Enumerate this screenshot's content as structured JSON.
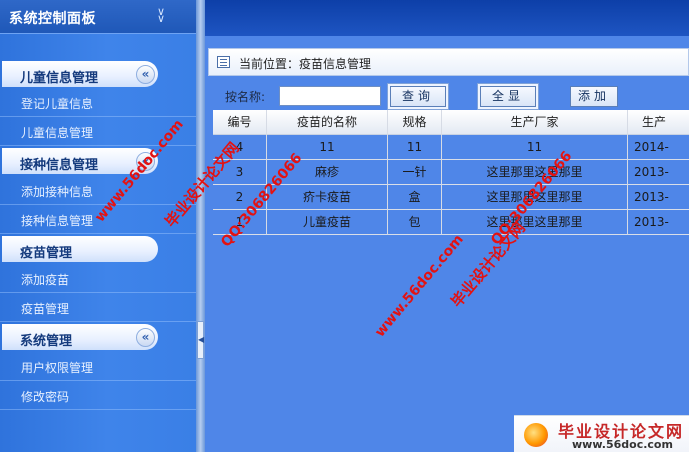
{
  "sidebar": {
    "title": "系统控制面板",
    "collapse_icon": "double-chevron-down-icon",
    "sections": [
      {
        "label": "儿童信息管理",
        "items": [
          "登记儿童信息",
          "儿童信息管理"
        ]
      },
      {
        "label": "接种信息管理",
        "items": [
          "添加接种信息",
          "接种信息管理"
        ]
      },
      {
        "label": "疫苗管理",
        "items": [
          "添加疫苗",
          "疫苗管理"
        ]
      },
      {
        "label": "系统管理",
        "items": [
          "用户权限管理",
          "修改密码"
        ]
      }
    ]
  },
  "main": {
    "breadcrumb": "当前位置：疫苗信息管理",
    "toolbar": {
      "search_label": "按名称:",
      "search_value": "",
      "query_button": "查询",
      "show_all_button": "全显",
      "add_button": "添加"
    },
    "table": {
      "headers": [
        "编号",
        "疫苗的名称",
        "规格",
        "生产厂家",
        "生产"
      ],
      "rows": [
        [
          "4",
          "11",
          "11",
          "11",
          "2014-"
        ],
        [
          "3",
          "麻疹",
          "一针",
          "这里那里这里那里",
          "2013-"
        ],
        [
          "2",
          "疥卡疫苗",
          "盒",
          "这里那里这里那里",
          "2013-"
        ],
        [
          "1",
          "儿童疫苗",
          "包",
          "这里那里这里那里",
          "2013-"
        ]
      ]
    }
  },
  "watermarks": {
    "site": "www.56doc.com",
    "qq": "QQ:306826066",
    "name": "毕业设计论文网"
  },
  "logo": {
    "title": "毕业设计论文网",
    "url": "www.56doc.com"
  },
  "colors": {
    "sidebar_bg": "#3a7fe6",
    "main_bg": "#4f86e8",
    "header_dark": "#0d3fa8",
    "watermark": "#e31212"
  }
}
